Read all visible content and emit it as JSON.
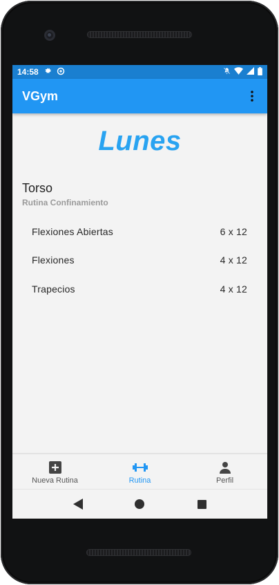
{
  "status_bar": {
    "time": "14:58",
    "left_icons": [
      "gear-icon",
      "data-saver-icon"
    ],
    "right_icons": [
      "silent-icon",
      "wifi-icon",
      "signal-icon",
      "battery-icon"
    ]
  },
  "app_bar": {
    "title": "VGym",
    "menu_icon": "more-vert-icon"
  },
  "colors": {
    "primary": "#2196f3",
    "status_bar": "#1a7fd0",
    "accent_title": "#29a3f1",
    "background": "#f3f3f3"
  },
  "day": {
    "title": "Lunes"
  },
  "routine": {
    "name": "Torso",
    "subtitle": "Rutina Confinamiento",
    "exercises": [
      {
        "name": "Flexiones Abiertas",
        "sets": "6 x 12"
      },
      {
        "name": "Flexiones",
        "sets": "4 x 12"
      },
      {
        "name": "Trapecios",
        "sets": "4 x 12"
      }
    ]
  },
  "bottom_nav": {
    "items": [
      {
        "label": "Nueva Rutina",
        "icon": "add-box-icon",
        "active": false
      },
      {
        "label": "Rutina",
        "icon": "dumbbell-icon",
        "active": true
      },
      {
        "label": "Perfil",
        "icon": "person-icon",
        "active": false
      }
    ]
  },
  "system_nav": {
    "buttons": [
      "back-icon",
      "home-icon",
      "recents-icon"
    ]
  }
}
